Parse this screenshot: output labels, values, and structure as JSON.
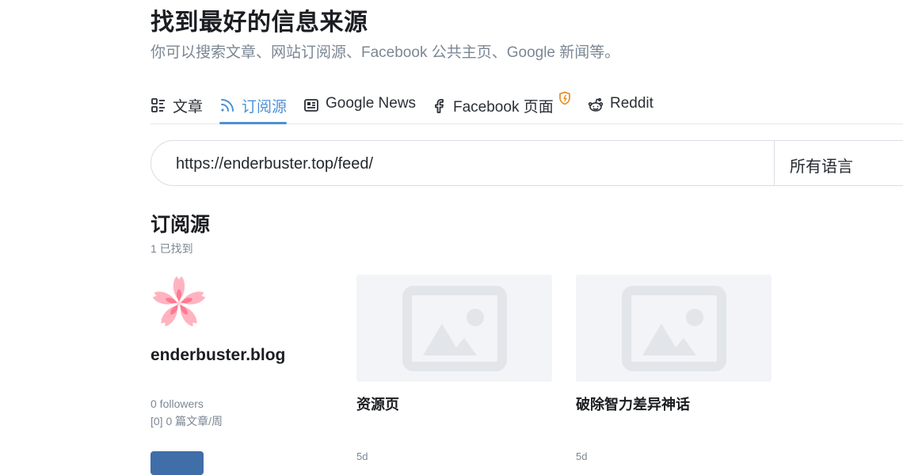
{
  "header": {
    "title": "找到最好的信息来源",
    "subtitle": "你可以搜索文章、网站订阅源、Facebook 公共主页、Google 新闻等。"
  },
  "tabs": [
    {
      "label": "文章",
      "icon": "article-icon",
      "active": false
    },
    {
      "label": "订阅源",
      "icon": "rss-icon",
      "active": true
    },
    {
      "label": "Google News",
      "icon": "newspaper-icon",
      "active": false
    },
    {
      "label": "Facebook 页面",
      "icon": "facebook-icon",
      "active": false,
      "badge": "pro-shield-icon"
    },
    {
      "label": "Reddit",
      "icon": "reddit-icon",
      "active": false
    }
  ],
  "search": {
    "value": "https://enderbuster.top/feed/",
    "language": "所有语言"
  },
  "results": {
    "title": "订阅源",
    "count": "1 已找到"
  },
  "feed": {
    "name": "enderbuster.blog",
    "followers": "0 followers",
    "stats": "[0] 0 篇文章/周"
  },
  "articles": [
    {
      "title": "资源页",
      "time": "5d"
    },
    {
      "title": "破除智力差异神话",
      "time": "5d"
    }
  ],
  "colors": {
    "accent": "#4d90d6",
    "button": "#3f6ea8",
    "muted": "#7b8794",
    "pro_badge": "#e8912d"
  }
}
